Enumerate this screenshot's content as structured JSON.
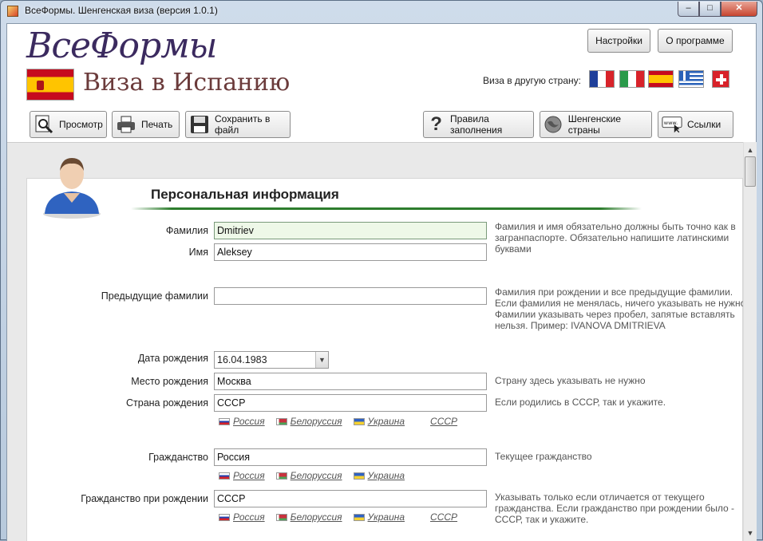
{
  "window": {
    "title": "ВсеФормы. Шенгенская виза (версия 1.0.1)",
    "minimize": "–",
    "maximize": "□",
    "close": "✕"
  },
  "header": {
    "logo": "ВсеФормы",
    "visa_title": "Виза в Испанию",
    "settings_label": "Настройки",
    "about_label": "О программе",
    "other_country_label": "Виза в другую страну:",
    "flags": [
      "france-flag",
      "italy-flag",
      "spain-flag",
      "greece-flag",
      "switzerland-flag"
    ]
  },
  "toolbar": {
    "preview": "Просмотр",
    "print": "Печать",
    "save": "Сохранить в файл",
    "rules": "Правила заполнения",
    "schengen": "Шенгенские страны",
    "links": "Ссылки"
  },
  "section": {
    "title": "Персональная информация"
  },
  "form": {
    "surname": {
      "label": "Фамилия",
      "value": "Dmitriev"
    },
    "name": {
      "label": "Имя",
      "value": "Aleksey"
    },
    "name_hint": "Фамилия и имя обязательно должны быть точно как в загранпаспорте. Обязательно напишите латинскими буквами",
    "prev_surnames": {
      "label": "Предыдущие фамилии",
      "value": "",
      "hint": "Фамилия при рождении и все предыдущие фамилии. Если фамилия не менялась, ничего указывать не нужно. Фамилии указывать через пробел, запятые вставлять нельзя. Пример: IVANOVA DMITRIEVA"
    },
    "birth_date": {
      "label": "Дата рождения",
      "value": "16.04.1983"
    },
    "birth_place": {
      "label": "Место рождения",
      "value": "Москва",
      "hint": "Страну здесь указывать не нужно"
    },
    "birth_country": {
      "label": "Страна рождения",
      "value": "СССР",
      "hint": "Если родились в СССР, так и укажите."
    },
    "citizenship": {
      "label": "Гражданство",
      "value": "Россия",
      "hint": "Текущее гражданство"
    },
    "birth_citizenship": {
      "label": "Гражданство при рождении",
      "value": "СССР",
      "hint": "Указывать только если отличается от текущего гражданства. Если гражданство при рождении было - СССР, так и укажите."
    }
  },
  "quick": {
    "russia": "Россия",
    "belarus": "Белоруссия",
    "ukraine": "Украина",
    "ussr": "СССР"
  },
  "colors": {
    "accent_green": "#2d7d2d",
    "title_purple": "#3b2a5f",
    "visa_brown": "#6b3b3b"
  }
}
